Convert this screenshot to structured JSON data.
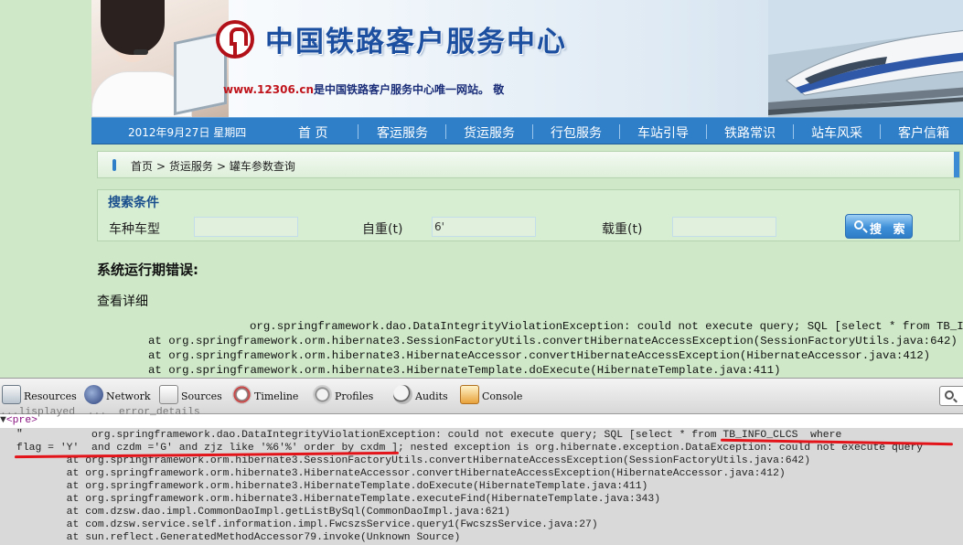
{
  "banner": {
    "site_title": "中国铁路客户服务中心",
    "tagline_url": "www.12306.cn",
    "tagline_text": "是中国铁路客户服务中心唯一网站。 敬"
  },
  "nav": {
    "date": "2012年9月27日 星期四",
    "items": [
      "首 页",
      "客运服务",
      "货运服务",
      "行包服务",
      "车站引导",
      "铁路常识",
      "站车风采",
      "客户信箱"
    ]
  },
  "breadcrumb": [
    "首页",
    "> 货运服务",
    "> 罐车参数查询"
  ],
  "search": {
    "title": "搜索条件",
    "car_type_label": "车种车型",
    "car_type_value": "",
    "tare_label": "自重(t)",
    "tare_value": "6'",
    "load_label": "载重(t)",
    "load_value": "",
    "button_label": "搜 索"
  },
  "error": {
    "heading": "系统运行期错误:",
    "detail_link": "查看详细",
    "trace_lines": [
      "org.springframework.dao.DataIntegrityViolationException: could not execute query; SQL [select * from TB_INFO_CLCS",
      "at org.springframework.orm.hibernate3.SessionFactoryUtils.convertHibernateAccessException(SessionFactoryUtils.java:642)",
      "at org.springframework.orm.hibernate3.HibernateAccessor.convertHibernateAccessException(HibernateAccessor.java:412)",
      "at org.springframework.orm.hibernate3.HibernateTemplate.doExecute(HibernateTemplate.java:411)"
    ]
  },
  "devtools": {
    "tabs": [
      "Resources",
      "Network",
      "Sources",
      "Timeline",
      "Profiles",
      "Audits",
      "Console"
    ],
    "partial_line": "...lisplayed  ...  error_details",
    "pre_tag": "<pre>",
    "quote": "\"",
    "lines": [
      "            org.springframework.dao.DataIntegrityViolationException: could not execute query; SQL [select * from TB_INFO_CLCS  where",
      "flag = 'Y'  and czdm ='G' and zjz like '%6'%' order by cxdm ]; nested exception is org.hibernate.exception.DataException: could not execute query",
      "        at org.springframework.orm.hibernate3.SessionFactoryUtils.convertHibernateAccessException(SessionFactoryUtils.java:642)",
      "        at org.springframework.orm.hibernate3.HibernateAccessor.convertHibernateAccessException(HibernateAccessor.java:412)",
      "        at org.springframework.orm.hibernate3.HibernateTemplate.doExecute(HibernateTemplate.java:411)",
      "        at org.springframework.orm.hibernate3.HibernateTemplate.executeFind(HibernateTemplate.java:343)",
      "        at com.dzsw.dao.impl.CommonDaoImpl.getListBySql(CommonDaoImpl.java:621)",
      "        at com.dzsw.service.self.information.impl.FwcszsService.query1(FwcszsService.java:27)",
      "        at sun.reflect.GeneratedMethodAccessor79.invoke(Unknown Source)"
    ]
  },
  "colors": {
    "page_bg": "#cfe9c8",
    "nav_blue": "#2f7fc8",
    "brand_red": "#b3111a",
    "annotation_red": "#e3141a"
  }
}
